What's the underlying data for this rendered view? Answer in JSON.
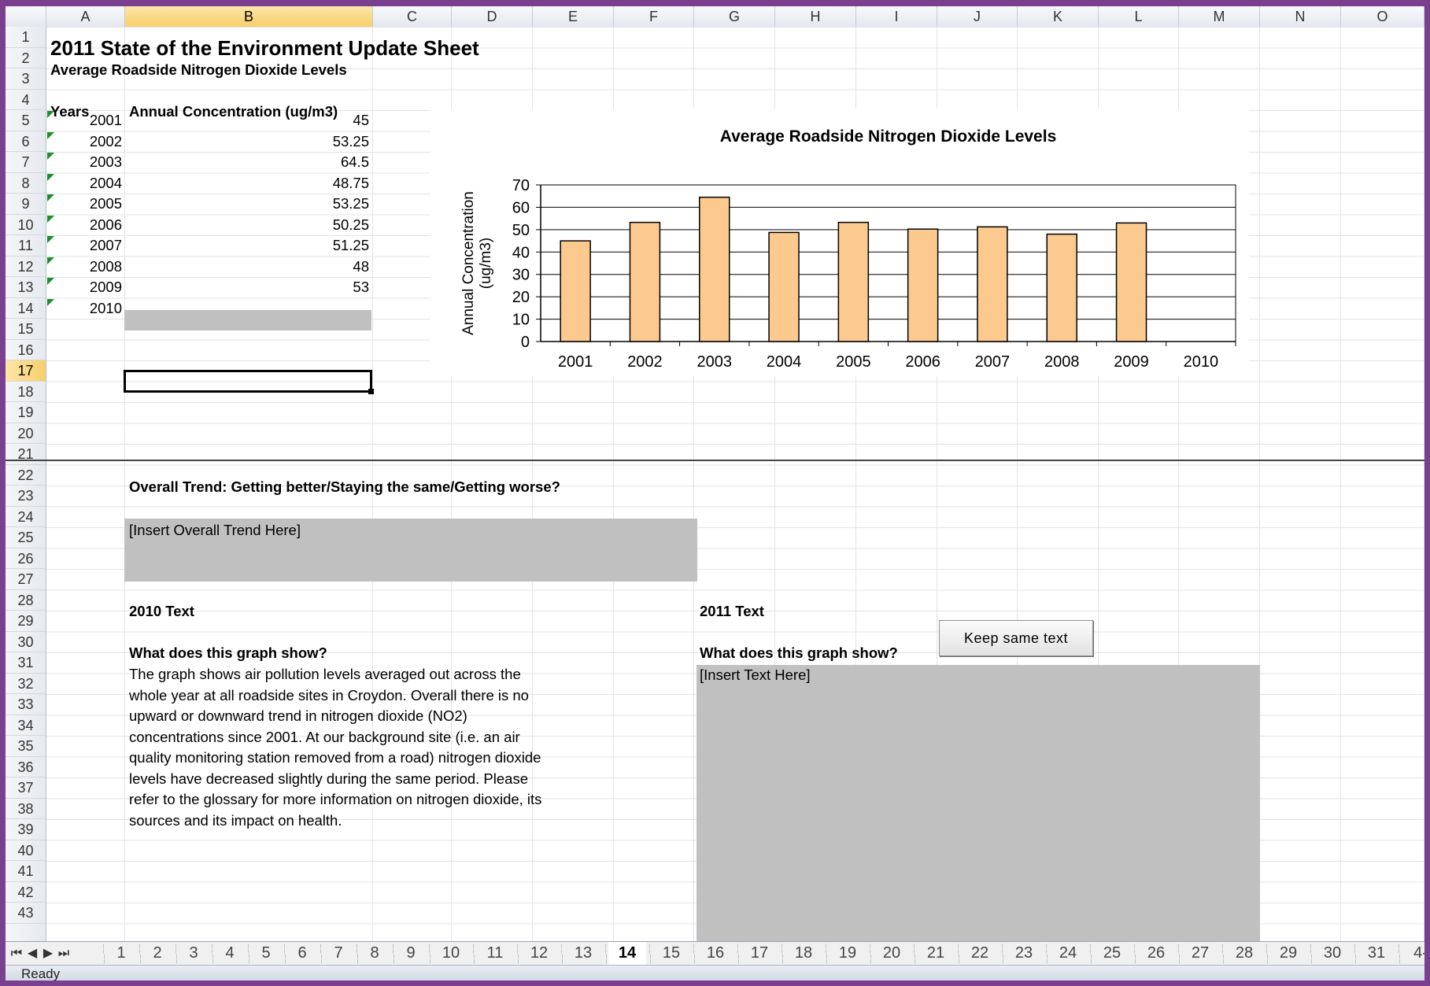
{
  "columns": [
    "A",
    "B",
    "C",
    "D",
    "E",
    "F",
    "G",
    "H",
    "I",
    "J",
    "K",
    "L",
    "M",
    "N",
    "O"
  ],
  "rows": [
    "1",
    "2",
    "3",
    "4",
    "5",
    "6",
    "7",
    "8",
    "9",
    "10",
    "11",
    "12",
    "13",
    "14",
    "15",
    "16",
    "17",
    "18",
    "19",
    "20",
    "21",
    "22",
    "23",
    "24",
    "25",
    "26",
    "27",
    "28",
    "29",
    "30",
    "31",
    "32",
    "33",
    "34",
    "35",
    "36",
    "37",
    "38",
    "39",
    "40",
    "41",
    "42",
    "43"
  ],
  "sheet": {
    "title": "2011 State of the Environment Update Sheet",
    "subtitle": "Average Roadside Nitrogen Dioxide Levels",
    "table": {
      "headers": [
        "Years",
        "Annual Concentration (ug/m3)"
      ],
      "rows": [
        {
          "year": "2001",
          "value": "45"
        },
        {
          "year": "2002",
          "value": "53.25"
        },
        {
          "year": "2003",
          "value": "64.5"
        },
        {
          "year": "2004",
          "value": "48.75"
        },
        {
          "year": "2005",
          "value": "53.25"
        },
        {
          "year": "2006",
          "value": "50.25"
        },
        {
          "year": "2007",
          "value": "51.25"
        },
        {
          "year": "2008",
          "value": "48"
        },
        {
          "year": "2009",
          "value": "53"
        },
        {
          "year": "2010",
          "value": ""
        }
      ]
    },
    "trend_question": "Overall Trend: Getting better/Staying the same/Getting worse?",
    "trend_placeholder": "[Insert Overall Trend Here]",
    "text2010_label": "2010 Text",
    "text2011_label": "2011 Text",
    "question_2010": "What does this graph show?",
    "question_2011": "What does this graph show?",
    "paragraph_2010": [
      "The graph shows air pollution levels averaged out across the",
      "whole year at all roadside sites in Croydon. Overall there is no",
      "upward or downward trend in nitrogen dioxide (NO2)",
      "concentrations since 2001. At our background site (i.e. an air",
      "quality monitoring station removed from a road) nitrogen dioxide",
      "levels have decreased slightly during the same period. Please",
      "refer to the glossary for more information on nitrogen dioxide, its",
      "sources and its impact on health."
    ],
    "text2011_placeholder": "[Insert Text Here]",
    "keep_button": "Keep same text",
    "selected_cell": "B17"
  },
  "chart_data": {
    "type": "bar",
    "title": "Average Roadside Nitrogen Dioxide Levels",
    "ylabel": "Annual Concentration (ug/m3)",
    "categories": [
      "2001",
      "2002",
      "2003",
      "2004",
      "2005",
      "2006",
      "2007",
      "2008",
      "2009",
      "2010"
    ],
    "values": [
      45,
      53.25,
      64.5,
      48.75,
      53.25,
      50.25,
      51.25,
      48,
      53,
      null
    ],
    "ylim": [
      0,
      70
    ],
    "yticks": [
      0,
      10,
      20,
      30,
      40,
      50,
      60,
      70
    ],
    "grid": true,
    "bar_color": "#fcc98f"
  },
  "tabs": [
    "1",
    "2",
    "3",
    "4",
    "5",
    "6",
    "7",
    "8",
    "9",
    "10",
    "11",
    "12",
    "13",
    "14",
    "15",
    "16",
    "17",
    "18",
    "19",
    "20",
    "21",
    "22",
    "23",
    "24",
    "25",
    "26",
    "27",
    "28",
    "29",
    "30",
    "31",
    "4-"
  ],
  "active_tab": "14",
  "status": "Ready"
}
